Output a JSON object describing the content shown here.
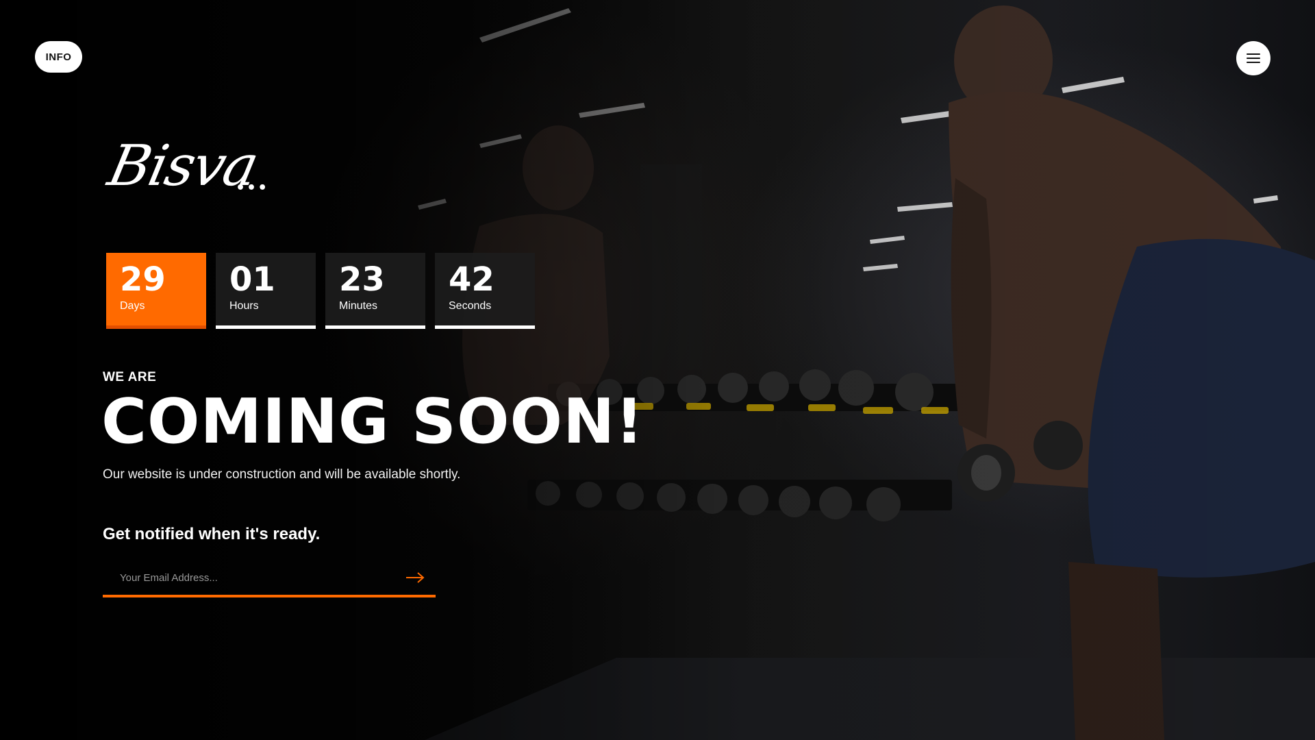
{
  "header": {
    "info_label": "INFO",
    "menu_icon": "hamburger-menu-icon"
  },
  "brand": {
    "logo_text": "Bisva",
    "logo_dots": "•••"
  },
  "countdown": [
    {
      "value": "29",
      "label": "Days",
      "active": true
    },
    {
      "value": "01",
      "label": "Hours",
      "active": false
    },
    {
      "value": "23",
      "label": "Minutes",
      "active": false
    },
    {
      "value": "42",
      "label": "Seconds",
      "active": false
    }
  ],
  "hero": {
    "eyebrow": "WE ARE",
    "headline": "COMING SOON!",
    "subtext": "Our website is under construction and will be available shortly."
  },
  "subscribe": {
    "heading": "Get notified when it's ready.",
    "placeholder": "Your Email Address...",
    "submit_icon": "arrow-right-icon"
  },
  "colors": {
    "accent": "#ff6a00",
    "background": "#050505",
    "text": "#ffffff"
  }
}
